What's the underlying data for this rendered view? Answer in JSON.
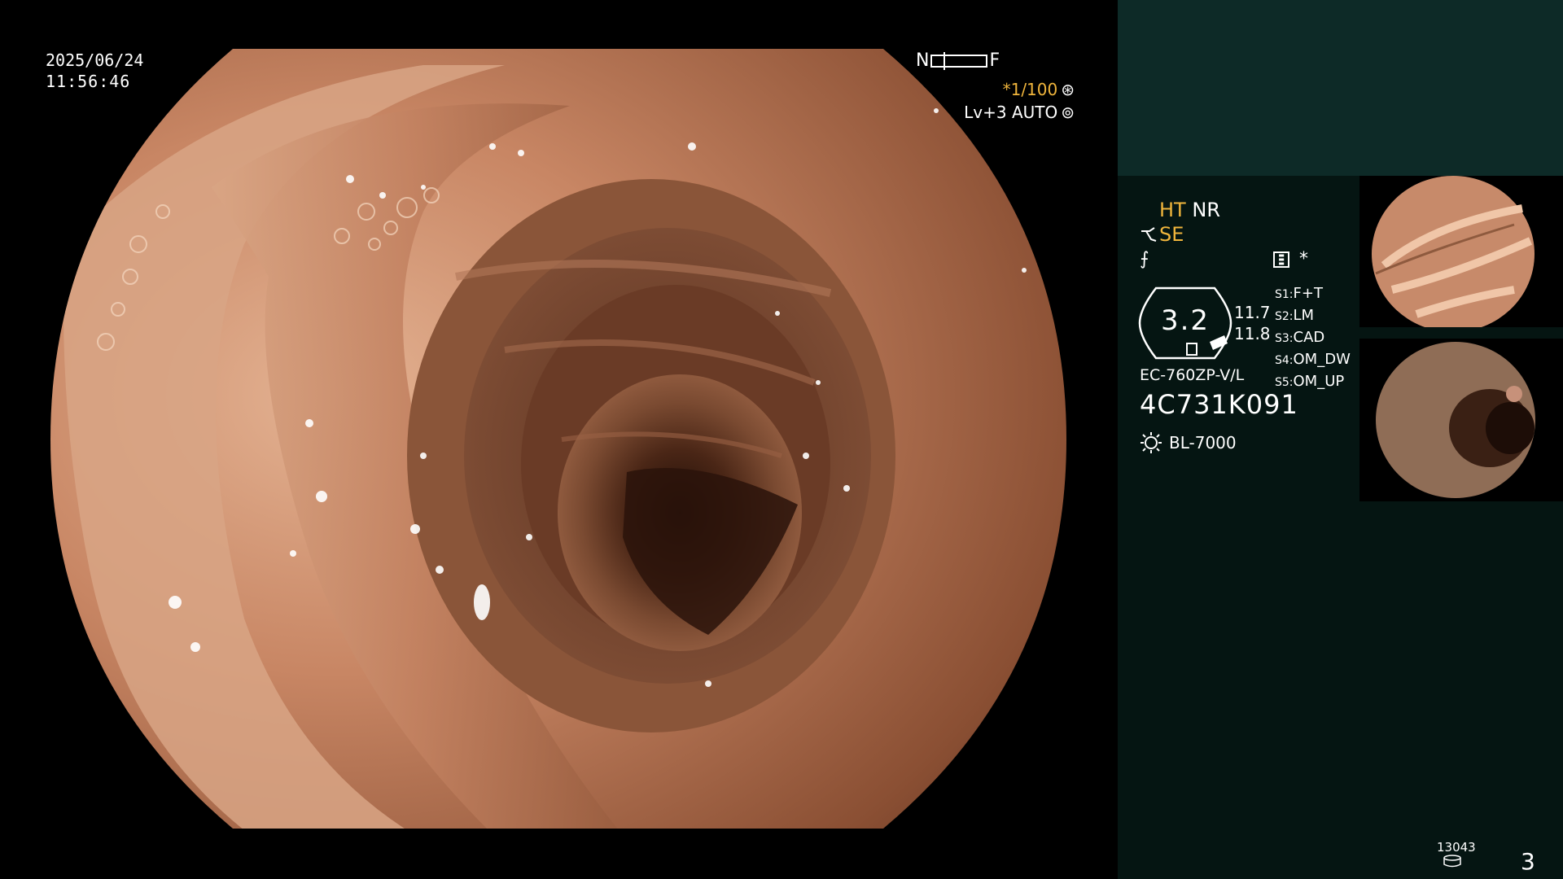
{
  "overlay": {
    "date": "2025/06/24",
    "time": "11:56:46",
    "near_label": "N",
    "far_label": "F",
    "shutter": "*1/100",
    "level": "Lv+3 AUTO"
  },
  "panel": {
    "mode_ht": "HT",
    "mode_nr": "NR",
    "mode_se": "SE",
    "gauge_value": "3.2",
    "gauge_right_1": "11.7",
    "gauge_right_2": "11.8",
    "menu_star": "*",
    "s_modes": [
      {
        "key": "S1:",
        "value": "F+T"
      },
      {
        "key": "S2:",
        "value": "LM"
      },
      {
        "key": "S3:",
        "value": "CAD"
      },
      {
        "key": "S4:",
        "value": "OM_DW"
      },
      {
        "key": "S5:",
        "value": "OM_UP"
      }
    ],
    "scope_model": "EC-760ZP-V/L",
    "serial": "4C731K091",
    "light_source": "BL-7000",
    "image_count": "13043",
    "page_number": "3"
  },
  "colors": {
    "accent_orange": "#f0b53c",
    "panel_top": "#0d2a27",
    "panel_bottom": "#051512"
  },
  "icons": [
    "aperture-icon",
    "auto-exposure-icon",
    "scope-bend-icon",
    "freeze-icon",
    "menu-icon",
    "gauge-icon",
    "light-source-icon",
    "disk-icon"
  ]
}
